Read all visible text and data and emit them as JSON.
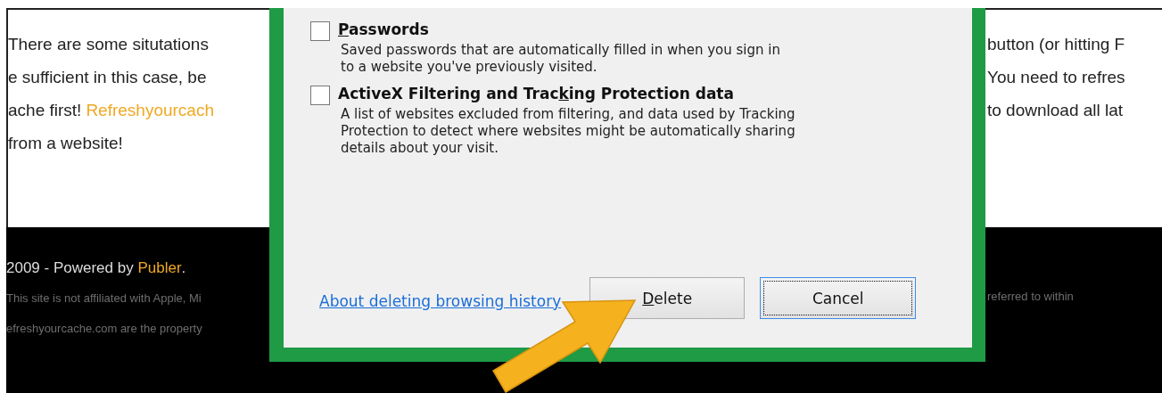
{
  "page": {
    "left_lines": [
      {
        "text": "There are some situtations"
      },
      {
        "text": "e sufficient in this case, be"
      },
      {
        "text": "ache first!",
        "link": "Refreshyourcach"
      },
      {
        "text": "from a website!"
      }
    ],
    "right_lines": [
      "button (or hitting F",
      "You need to refres",
      "to download all lat"
    ]
  },
  "footer": {
    "credit": "2009 - Powered by",
    "credit_link": "Publer",
    "credit_end": ".",
    "left_notes": [
      "This site is not affiliated with Apple, Mi",
      "efreshyourcache.com are the property"
    ],
    "right_notes": [
      "referred to within"
    ]
  },
  "dialog": {
    "options": [
      {
        "label": {
          "key": "P",
          "after": "asswords"
        },
        "checked": false,
        "description_lines": [
          "Saved passwords that are automatically filled in when you sign in",
          "to a website you've previously visited."
        ]
      },
      {
        "label": {
          "before": "ActiveX Filtering and Trac",
          "key": "k",
          "after": "ing Protection data"
        },
        "checked": false,
        "description_lines": [
          "A list of websites excluded from filtering, and data used by Tracking",
          "Protection to detect where websites might be automatically sharing",
          "details about your visit."
        ]
      }
    ],
    "help_link": "About deleting browsing history",
    "buttons": [
      {
        "label": {
          "key": "D",
          "after": "elete"
        },
        "focused": false
      },
      {
        "label": {
          "after": "Cancel"
        },
        "focused": true
      }
    ]
  }
}
